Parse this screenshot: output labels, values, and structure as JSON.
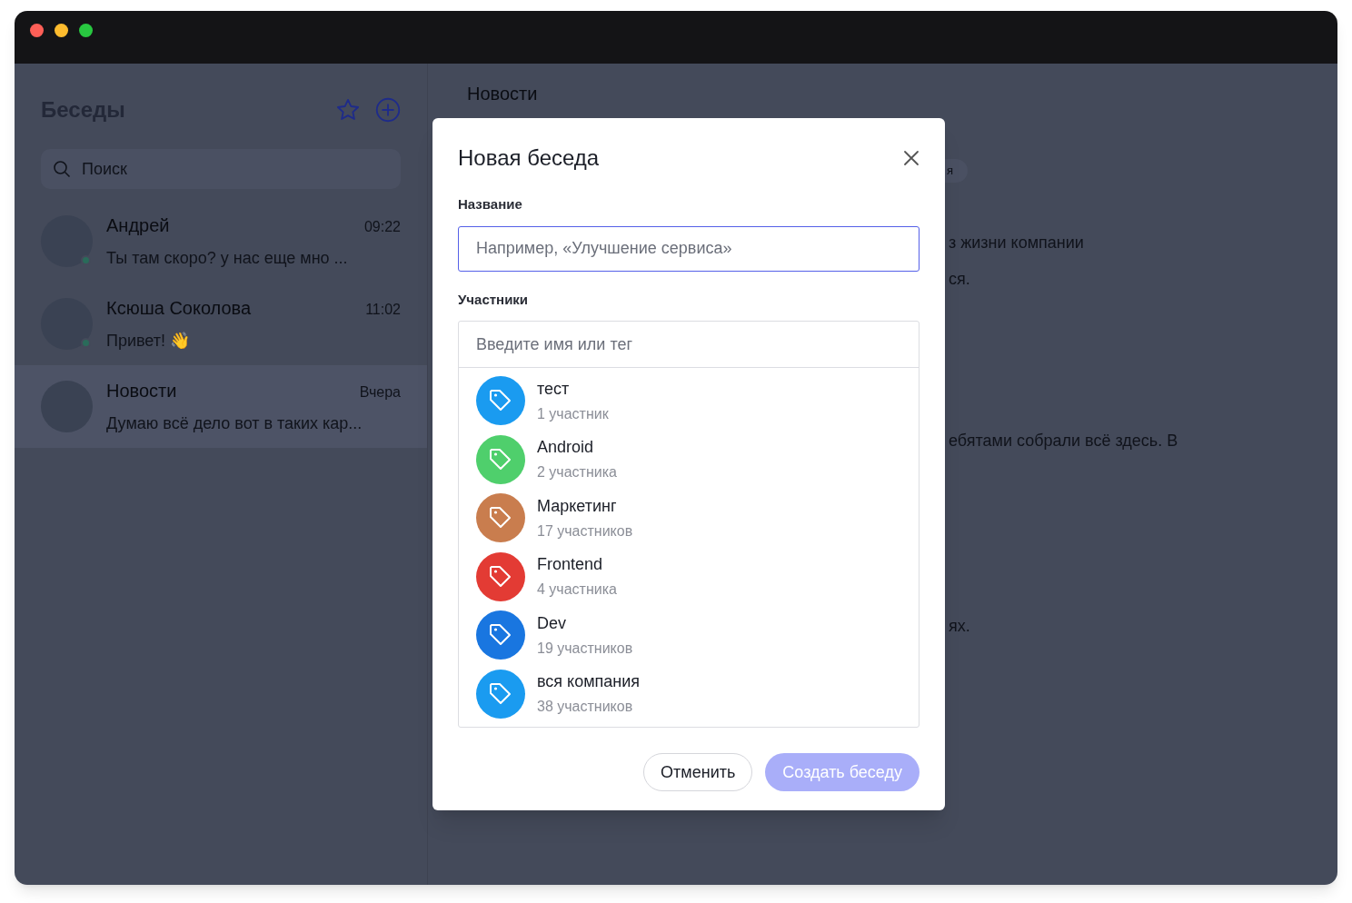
{
  "sidebar": {
    "title": "Беседы",
    "search": {
      "placeholder": "Поиск"
    },
    "chats": [
      {
        "name": "Андрей",
        "time": "09:22",
        "preview": "Ты там скоро? у нас еще мно ...",
        "online": true,
        "selected": false
      },
      {
        "name": "Ксюша Соколова",
        "time": "11:02",
        "preview": "Привет! 👋",
        "online": true,
        "selected": false
      },
      {
        "name": "Новости",
        "time": "Вчера",
        "preview": "Думаю всё дело вот в таких кар...",
        "online": false,
        "selected": true
      }
    ]
  },
  "chat": {
    "title": "Новости",
    "chip": "я",
    "fragments": [
      "з жизни компании",
      "ся.",
      "ебятами собрали всё здесь. В",
      "ях."
    ]
  },
  "dialog": {
    "title": "Новая беседа",
    "name_label": "Название",
    "name_field": {
      "placeholder": "Например, «Улучшение сервиса»"
    },
    "members_label": "Участники",
    "members_field": {
      "placeholder": "Введите имя или тег"
    },
    "tags": [
      {
        "name": "тест",
        "count": "1 участник",
        "color": "#1a9bf0"
      },
      {
        "name": "Android",
        "count": "2 участника",
        "color": "#4fcf6c"
      },
      {
        "name": "Маркетинг",
        "count": "17 участников",
        "color": "#c97d4e"
      },
      {
        "name": "Frontend",
        "count": "4 участника",
        "color": "#e33b34"
      },
      {
        "name": "Dev",
        "count": "19 участников",
        "color": "#1976e0"
      },
      {
        "name": "вся компания",
        "count": "38 участников",
        "color": "#1a9bf0"
      }
    ],
    "cancel": "Отменить",
    "create": {
      "label": "Создать беседу",
      "disabled": true
    }
  }
}
